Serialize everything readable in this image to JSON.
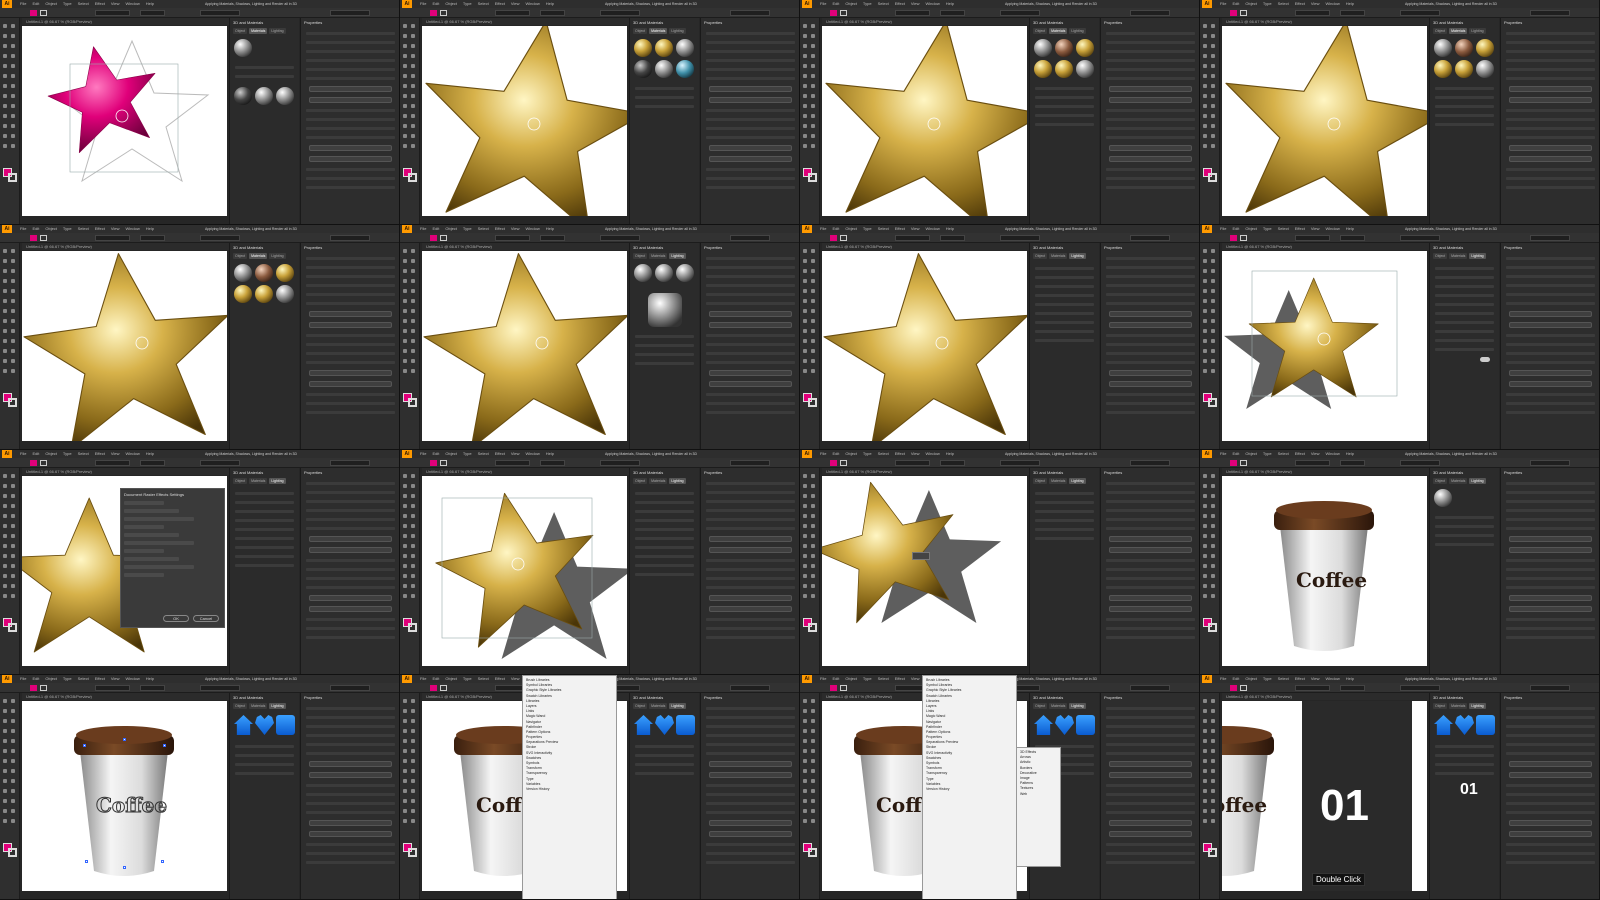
{
  "app": {
    "logo": "Ai",
    "menu": [
      "File",
      "Edit",
      "Object",
      "Type",
      "Select",
      "Effect",
      "View",
      "Window",
      "Help"
    ],
    "document_tab": "Untitled-1 @ 66.67 % (RGB/Preview)",
    "window_title": "Applying Materials, Shadows, Lighting and Render all in 3D"
  },
  "panels": {
    "materials_title": "3D and Materials",
    "tabs": [
      "Object",
      "Materials",
      "Lighting"
    ],
    "properties_title": "Properties"
  },
  "dialog": {
    "title": "Document Raster Effects Settings",
    "ok": "OK",
    "cancel": "Cancel"
  },
  "cup": {
    "label": "Coffee"
  },
  "overlay": {
    "big_number": "01",
    "double_click": "Double Click"
  },
  "menu_items": [
    "Brush Libraries",
    "Symbol Libraries",
    "Graphic Style Libraries",
    "Swatch Libraries",
    "Libraries",
    "Layers",
    "Links",
    "Magic Wand",
    "Navigator",
    "Pathfinder",
    "Pattern Options",
    "Properties",
    "Separations Preview",
    "Stroke",
    "SVG Interactivity",
    "Swatches",
    "Symbols",
    "Transform",
    "Transparency",
    "Type",
    "Variables",
    "Version History"
  ],
  "submenu_items": [
    "3D Effects",
    "Arrows",
    "Artistic",
    "Borders",
    "Decorative",
    "Image",
    "Patterns",
    "Textures",
    "Web"
  ],
  "colors": {
    "accent_fill": "#e0007a",
    "gold": "#c9a23a",
    "cup_lid": "#5a3218"
  }
}
